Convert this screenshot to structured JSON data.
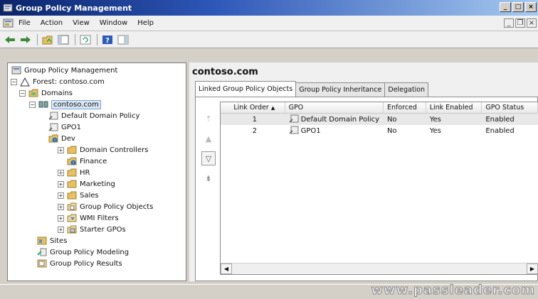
{
  "window": {
    "title": "Group Policy Management"
  },
  "menu": {
    "items": [
      {
        "label": "File"
      },
      {
        "label": "Action"
      },
      {
        "label": "View"
      },
      {
        "label": "Window"
      },
      {
        "label": "Help"
      }
    ]
  },
  "tree": {
    "root": "Group Policy Management",
    "forest": "Forest: contoso.com",
    "domains": "Domains",
    "domain": "contoso.com",
    "children": [
      "Default Domain Policy",
      "GPO1",
      "Dev",
      "Domain Controllers",
      "Finance",
      "HR",
      "Marketing",
      "Sales",
      "Group Policy Objects",
      "WMI Filters",
      "Starter GPOs"
    ],
    "sites": "Sites",
    "modeling": "Group Policy Modeling",
    "results": "Group Policy Results"
  },
  "main": {
    "title": "contoso.com",
    "tabs": [
      {
        "label": "Linked Group Policy Objects"
      },
      {
        "label": "Group Policy Inheritance"
      },
      {
        "label": "Delegation"
      }
    ],
    "table": {
      "columns": [
        "Link Order",
        "GPO",
        "Enforced",
        "Link Enabled",
        "GPO Status"
      ],
      "rows": [
        {
          "order": "1",
          "gpo": "Default Domain Policy",
          "enforced": "No",
          "link_enabled": "Yes",
          "status": "Enabled"
        },
        {
          "order": "2",
          "gpo": "GPO1",
          "enforced": "No",
          "link_enabled": "Yes",
          "status": "Enabled"
        }
      ]
    }
  },
  "watermark": "www.passleader.com"
}
